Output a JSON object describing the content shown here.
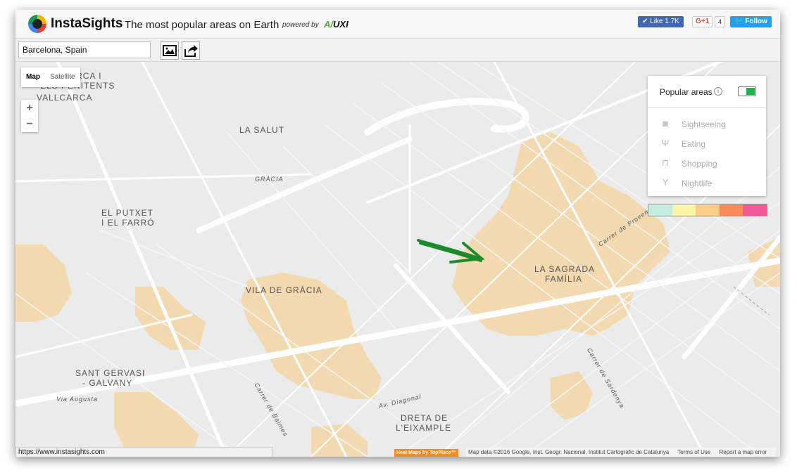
{
  "header": {
    "brand": "InstaSights",
    "tagline": "The most popular areas on Earth",
    "powered_by": "powered by",
    "partner_a": "A",
    "partner_slash": "/",
    "partner_b": "UXI",
    "like": "✔ Like 1.7K",
    "gplus": "G+1",
    "gplus_count": "4",
    "follow": "Follow"
  },
  "toolbar": {
    "search_value": "Barcelona, Spain"
  },
  "map_controls": {
    "map_label": "Map",
    "satellite_label": "Satellite",
    "zoom_in": "+",
    "zoom_out": "−"
  },
  "panel": {
    "title": "Popular areas",
    "info": "i",
    "toggle_on": true,
    "categories": [
      {
        "label": "Sightseeing",
        "icon": "camera-icon"
      },
      {
        "label": "Eating",
        "icon": "fork-knife-icon"
      },
      {
        "label": "Shopping",
        "icon": "shopping-bag-icon"
      },
      {
        "label": "Nightlife",
        "icon": "cocktail-icon"
      }
    ],
    "legend_colors": [
      "#c6eee0",
      "#fcf4a6",
      "#fdcd8a",
      "#fb8a5c",
      "#ef5a97"
    ]
  },
  "map_labels": {
    "vallcarca_a": "VALLCARCA I",
    "vallcarca_b": "ELS PENITENTS",
    "vallcarca": "VALLCARCA",
    "la_salut": "LA SALUT",
    "gracia": "GRÀCIA",
    "putxet_a": "EL PUTXET",
    "putxet_b": "I EL FARRÓ",
    "vila_gracia": "VILA DE GRÀCIA",
    "sagrada_a": "LA SAGRADA",
    "sagrada_b": "FAMÍLIA",
    "sant_gervasi_a": "SANT GERVASI",
    "sant_gervasi_b": "- GALVANY",
    "dreta_a": "DRETA DE",
    "dreta_b": "L'EIXAMPLE",
    "street_1": "Av. Diagonal",
    "street_2": "Carrer de Balmes",
    "street_3": "Via Augusta",
    "street_4": "Carrer de Sardenya",
    "street_5": "Carrer de Provença"
  },
  "footer": {
    "status_url": "https://www.instasights.com",
    "heatmap_badge": "Heat Maps by TopPlace™",
    "map_data": "Map data ©2016 Google, Inst. Geogr. Nacional, Institut Cartogràfic de Catalunya",
    "terms": "Terms of Use",
    "report": "Report a map error"
  },
  "colors": {
    "heat": "#f3d9b0",
    "arrow": "#1e8a2e",
    "toggle": "#1fb24a"
  }
}
